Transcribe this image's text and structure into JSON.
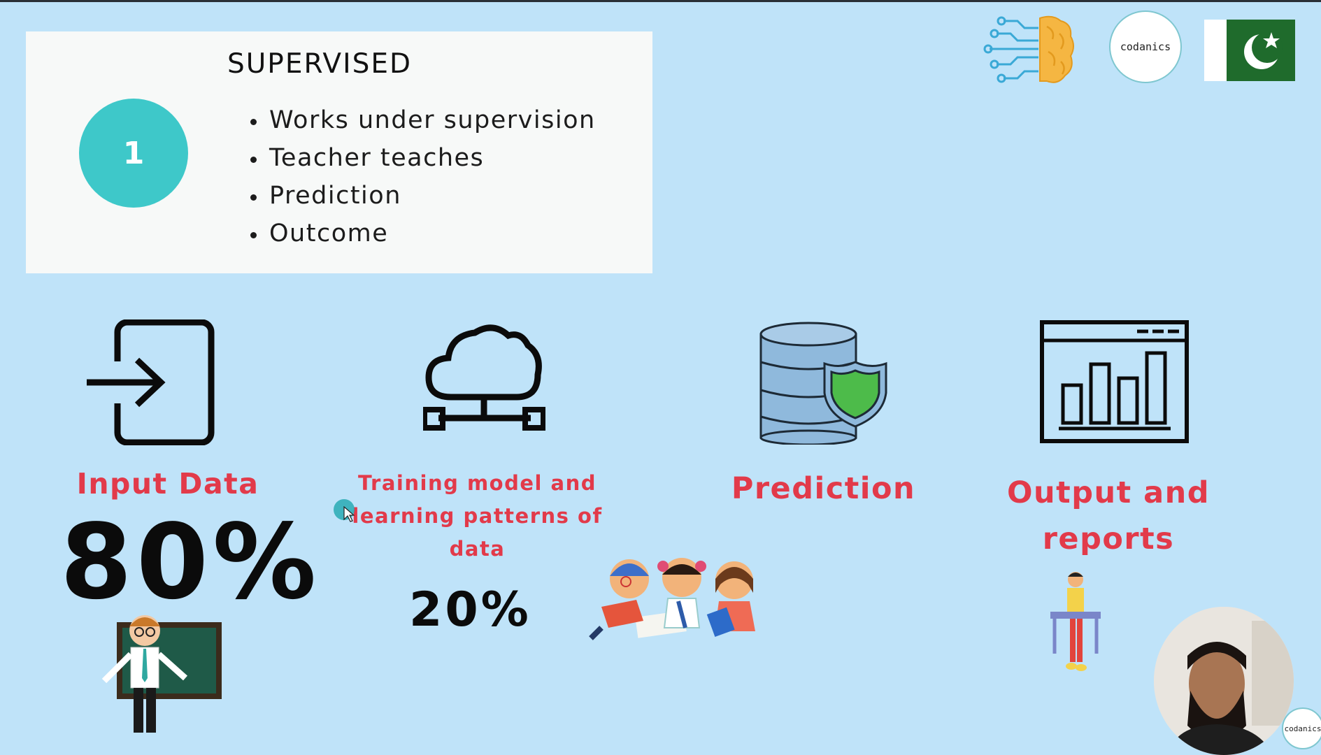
{
  "card": {
    "title": "SUPERVISED",
    "step_number": "1",
    "bullets": [
      "Works under supervision",
      "Teacher teaches",
      "Prediction",
      "Outcome"
    ]
  },
  "logos": {
    "codanics": "codanics",
    "badge": "codanics"
  },
  "sections": {
    "input": {
      "label": "Input Data",
      "percent": "80%"
    },
    "training": {
      "label_line1": "Training model and",
      "label_line2": "learning patterns of",
      "label_line3": "data",
      "percent": "20%"
    },
    "prediction": {
      "label": "Prediction"
    },
    "output": {
      "label_line1": "Output and",
      "label_line2": "reports"
    }
  },
  "colors": {
    "background": "#bfe3f9",
    "accent_red": "#e23a4a",
    "teal": "#3ec8c9",
    "db_blue": "#8fb9dc",
    "shield_green": "#4dbb4a"
  },
  "icons": [
    "login-icon",
    "cloud-network-icon",
    "database-shield-icon",
    "bar-chart-window-icon"
  ]
}
